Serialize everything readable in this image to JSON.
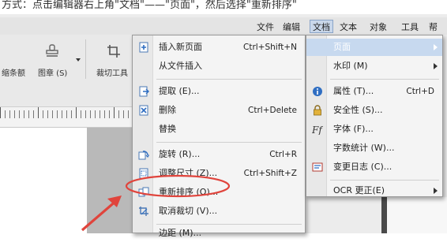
{
  "caption": "方式：点击编辑器右上角\"文档\"——\"页面\"，然后选择\"重新排序\"",
  "menubar": {
    "items": [
      "文件",
      "编辑",
      "文档",
      "文本",
      "对象",
      "工具",
      "帮助"
    ],
    "active": "文档"
  },
  "toolbar": {
    "items": [
      {
        "label": "缩条额",
        "icon": "stamp-icon"
      },
      {
        "label": "图章 (S)",
        "icon": "stamp-icon"
      },
      {
        "label": "裁切工具",
        "icon": "crop-icon"
      }
    ]
  },
  "document_menu": {
    "items": [
      {
        "label": "插入新页面",
        "shortcut": "Ctrl+Shift+N",
        "icon": "insert-page-icon"
      },
      {
        "label": "从文件插入",
        "shortcut": "",
        "icon": ""
      },
      {
        "label": "提取 (E)...",
        "shortcut": "",
        "icon": "extract-icon"
      },
      {
        "label": "删除",
        "shortcut": "Ctrl+Delete",
        "icon": "delete-page-icon"
      },
      {
        "label": "替换",
        "shortcut": "",
        "icon": ""
      },
      {
        "label": "旋转 (R)...",
        "shortcut": "Ctrl+R",
        "icon": "rotate-icon"
      },
      {
        "label": "调整尺寸 (Z)...",
        "shortcut": "Ctrl+Shift+Z",
        "icon": "resize-icon"
      },
      {
        "label": "重新排序 (O)...",
        "shortcut": "",
        "icon": "reorder-icon"
      },
      {
        "label": "取消裁切 (V)...",
        "shortcut": "",
        "icon": "uncrop-icon"
      },
      {
        "label": "边距 (M)...",
        "shortcut": "",
        "icon": ""
      }
    ]
  },
  "pages_submenu": {
    "items": [
      {
        "label": "页面",
        "shortcut": "",
        "submenu": true,
        "highlighted": true
      },
      {
        "label": "水印 (M)",
        "shortcut": "",
        "submenu": true
      },
      {
        "label": "属性 (T)...",
        "shortcut": "Ctrl+D",
        "icon": "info-icon"
      },
      {
        "label": "安全性 (S)...",
        "shortcut": "",
        "icon": "lock-icon"
      },
      {
        "label": "字体 (F)...",
        "shortcut": "",
        "icon": "font-icon"
      },
      {
        "label": "字数统计 (W)...",
        "shortcut": ""
      },
      {
        "label": "变更日志 (C)...",
        "shortcut": "",
        "icon": "changelog-icon"
      },
      {
        "label": "OCR 更正(E)",
        "shortcut": "",
        "submenu": true
      }
    ]
  },
  "colors": {
    "annotation_red": "#e0443c",
    "highlight": "#c7d9ef",
    "menu_bg": "#f4f4f4"
  }
}
